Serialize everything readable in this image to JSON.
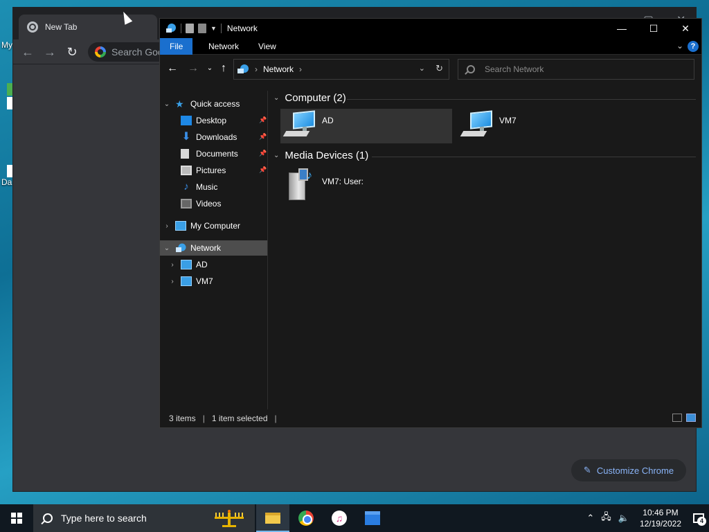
{
  "desktop": {
    "labels": [
      "My",
      "Da"
    ]
  },
  "chrome": {
    "tab_title": "New Tab",
    "omnibox_placeholder": "Search Goo",
    "customize_label": "Customize Chrome"
  },
  "explorer": {
    "title": "Network",
    "ribbon_tabs": [
      "File",
      "Network",
      "View"
    ],
    "help_label": "?",
    "address": {
      "segment": "Network"
    },
    "search_placeholder": "Search Network",
    "nav_pane": {
      "quick_access": "Quick access",
      "items": [
        "Desktop",
        "Downloads",
        "Documents",
        "Pictures",
        "Music",
        "Videos"
      ],
      "my_computer": "My Computer",
      "network": "Network",
      "network_children": [
        "AD",
        "VM7"
      ]
    },
    "groups": [
      {
        "header": "Computer (2)",
        "items": [
          "AD",
          "VM7"
        ]
      },
      {
        "header": "Media Devices (1)",
        "items": [
          "VM7: User:"
        ]
      }
    ],
    "status": {
      "count": "3 items",
      "selection": "1 item selected"
    }
  },
  "taskbar": {
    "search_placeholder": "Type here to search",
    "time": "10:46 PM",
    "date": "12/19/2022",
    "notification_count": "4"
  },
  "colors": {
    "accent": "#1a6fce",
    "explorer_bg": "#191919",
    "chrome_link": "#8ab4f8",
    "taskbar_bg": "#101820"
  }
}
